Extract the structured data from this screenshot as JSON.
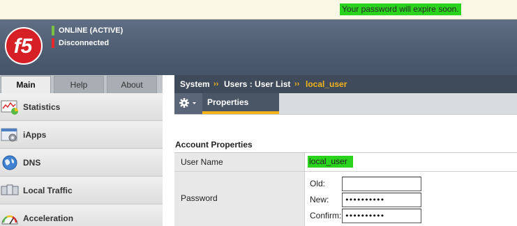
{
  "notice": {
    "text": "Your password will expire soon."
  },
  "header": {
    "status_online": "ONLINE (ACTIVE)",
    "status_connection": "Disconnected",
    "colors": {
      "online": "#7bc143",
      "disconnected": "#e8262c",
      "logo": "#d71f26"
    }
  },
  "logo": {
    "text": "f5",
    "icon": "f5-logo"
  },
  "tabs": [
    {
      "label": "Main",
      "active": true
    },
    {
      "label": "Help",
      "active": false
    },
    {
      "label": "About",
      "active": false
    }
  ],
  "sidebar": {
    "items": [
      {
        "label": "Statistics",
        "icon": "statistics-icon"
      },
      {
        "label": "iApps",
        "icon": "iapps-icon"
      },
      {
        "label": "DNS",
        "icon": "dns-globe-icon"
      },
      {
        "label": "Local Traffic",
        "icon": "local-traffic-icon"
      },
      {
        "label": "Acceleration",
        "icon": "acceleration-gauge-icon"
      }
    ]
  },
  "breadcrumb": {
    "items": [
      "System",
      "Users : User List",
      "local_user"
    ],
    "separator": "››",
    "accent": "#f4b41a"
  },
  "toolbar": {
    "properties_tab": "Properties",
    "gear_icon": "gear-icon"
  },
  "account": {
    "section_title": "Account Properties",
    "user_name_label": "User Name",
    "user_name_value": "local_user",
    "password_label": "Password",
    "old_label": "Old:",
    "old_value": "",
    "new_label": "New:",
    "new_value": "••••••••••",
    "confirm_label": "Confirm:",
    "confirm_value": "••••••••••"
  }
}
